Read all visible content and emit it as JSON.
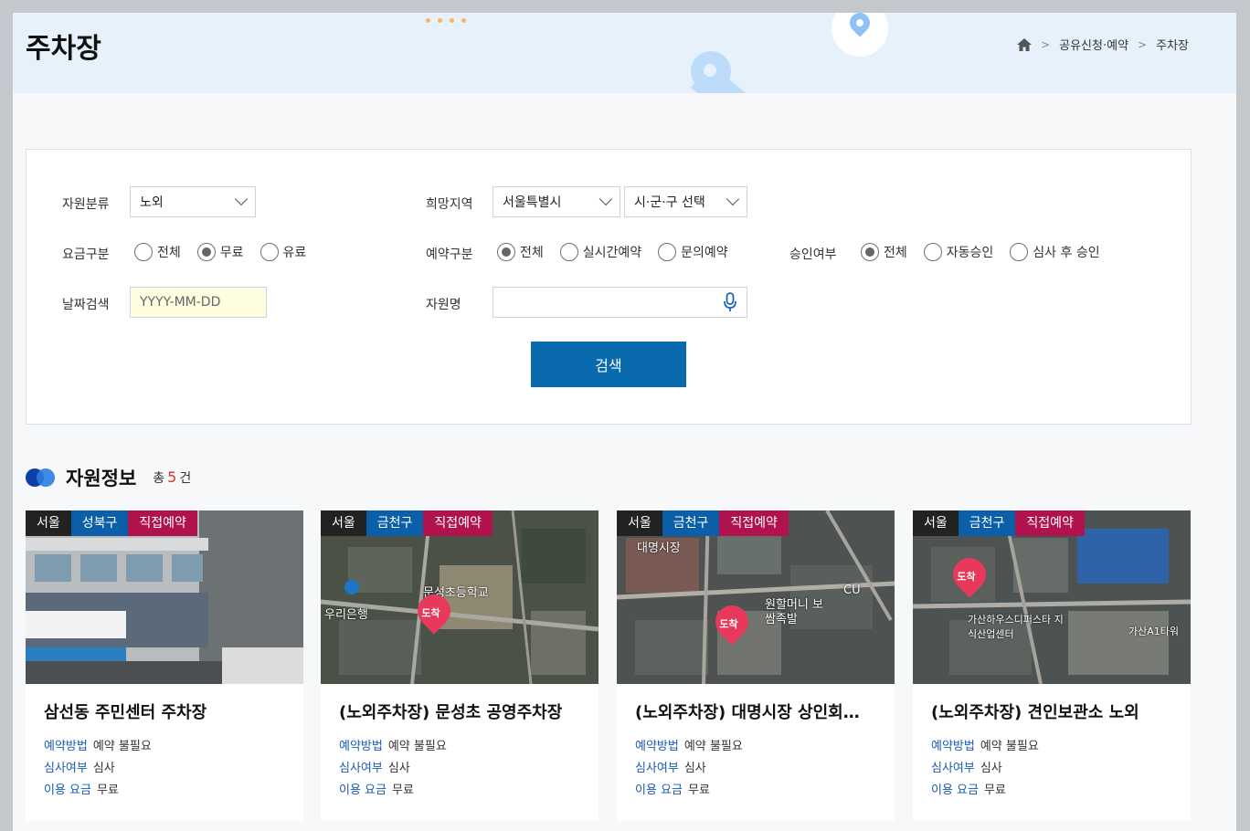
{
  "header": {
    "title": "주차장",
    "breadcrumb": [
      "공유신청·예약",
      "주차장"
    ],
    "colors": {
      "banner": "#e7f1fc"
    }
  },
  "search": {
    "resource_type": {
      "label": "자원분류",
      "value": "노외"
    },
    "region": {
      "label": "희망지역",
      "city": "서울특별시",
      "district": "시·군·구 선택"
    },
    "fee": {
      "label": "요금구분",
      "options": [
        "전체",
        "무료",
        "유료"
      ],
      "selected": "무료"
    },
    "reservation": {
      "label": "예약구분",
      "options": [
        "전체",
        "실시간예약",
        "문의예약"
      ],
      "selected": "전체"
    },
    "approval": {
      "label": "승인여부",
      "options": [
        "전체",
        "자동승인",
        "심사 후 승인"
      ],
      "selected": "전체"
    },
    "date": {
      "label": "날짜검색",
      "placeholder": "YYYY-MM-DD"
    },
    "name": {
      "label": "자원명",
      "placeholder": ""
    },
    "button": "검색",
    "colors": {
      "button": "#0a6aae",
      "date_bg": "#fffde0"
    }
  },
  "results": {
    "title": "자원정보",
    "count_prefix": "총",
    "count": "5",
    "count_suffix": "건",
    "colors": {
      "count": "#d2342b",
      "tag_region": "#222222",
      "tag_district": "#0a5fa8",
      "tag_method": "#b0124e",
      "meta_key": "#1a5bb3"
    },
    "cards": [
      {
        "region": "서울",
        "district": "성북구",
        "method": "직접예약",
        "title": "삼선동 주민센터 주차장",
        "meta": [
          {
            "k": "예약방법",
            "v": "예약 불필요"
          },
          {
            "k": "심사여부",
            "v": "심사"
          },
          {
            "k": "이용 요금",
            "v": "무료"
          }
        ],
        "thumb_type": "photo"
      },
      {
        "region": "서울",
        "district": "금천구",
        "method": "직접예약",
        "title": "(노외주차장) 문성초 공영주차장",
        "meta": [
          {
            "k": "예약방법",
            "v": "예약 불필요"
          },
          {
            "k": "심사여부",
            "v": "심사"
          },
          {
            "k": "이용 요금",
            "v": "무료"
          }
        ],
        "thumb_type": "map",
        "pin": "도착",
        "labels": [
          "우리은행",
          "문성초등학교"
        ]
      },
      {
        "region": "서울",
        "district": "금천구",
        "method": "직접예약",
        "title": "(노외주차장) 대명시장 상인회…",
        "meta": [
          {
            "k": "예약방법",
            "v": "예약 불필요"
          },
          {
            "k": "심사여부",
            "v": "심사"
          },
          {
            "k": "이용 요금",
            "v": "무료"
          }
        ],
        "thumb_type": "map",
        "pin": "도착",
        "labels": [
          "대명시장",
          "CU",
          "원할머니 보쌈족발"
        ]
      },
      {
        "region": "서울",
        "district": "금천구",
        "method": "직접예약",
        "title": "(노외주차장) 견인보관소 노외",
        "meta": [
          {
            "k": "예약방법",
            "v": "예약 불필요"
          },
          {
            "k": "심사여부",
            "v": "심사"
          },
          {
            "k": "이용 요금",
            "v": "무료"
          }
        ],
        "thumb_type": "map",
        "pin": "도착",
        "labels": [
          "가산하우스디퍼스타 지식산업센터",
          "가산A1타워"
        ]
      }
    ]
  }
}
